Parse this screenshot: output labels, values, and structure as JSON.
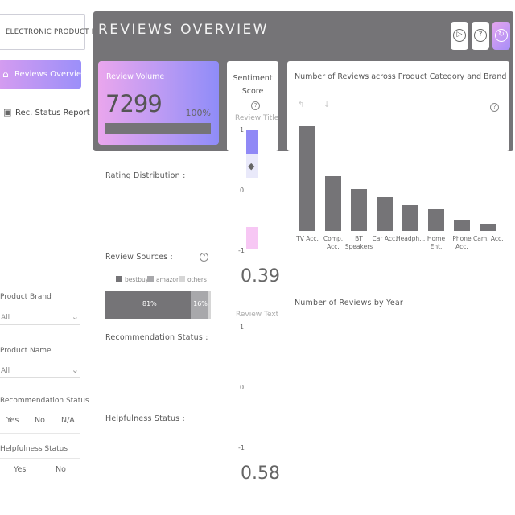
{
  "app": {
    "logo_text": "ELECTRONIC PRODUCT DATA"
  },
  "nav": [
    {
      "label": "Reviews Overview",
      "icon": "home-icon",
      "active": true
    },
    {
      "label": "Rec. Status Report",
      "icon": "report-icon",
      "active": false
    }
  ],
  "filters": {
    "brand": {
      "label": "Product Brand",
      "value": "All"
    },
    "name": {
      "label": "Product Name",
      "value": "All"
    },
    "recommendation": {
      "label": "Recommendation Status",
      "options": [
        "Yes",
        "No",
        "N/A"
      ]
    },
    "helpfulness": {
      "label": "Helpfulness Status",
      "options": [
        "Yes",
        "No"
      ]
    }
  },
  "header": {
    "title": "REVIEWS OVERVIEW",
    "buttons": [
      "play-circle-icon",
      "help-icon",
      "refresh-icon"
    ]
  },
  "colors": {
    "accent_start": "#eaa6ed",
    "accent_end": "#8f8cf8",
    "header": "#757477"
  },
  "review_volume": {
    "label": "Review Volume",
    "value": "7299",
    "percent": "100%"
  },
  "sentiment": {
    "title_line1": "Sentiment",
    "title_line2": "Score",
    "review_title_label": "Review Title",
    "review_title_score": "0.39",
    "review_text_label": "Review Text",
    "review_text_score": "0.58",
    "axis": [
      "1",
      "0",
      "-1"
    ]
  },
  "sections": {
    "rating_distribution": "Rating Distribution :",
    "review_sources": "Review Sources :",
    "recommendation_status": "Recommendation Status :",
    "helpfulness_status": "Helpfulness Status :",
    "reviews_by_year": "Number of Reviews by Year"
  },
  "review_sources": {
    "legend": [
      "bestbuy",
      "amazon",
      "others"
    ],
    "values": [
      81,
      16,
      3
    ],
    "labels": [
      "81%",
      "16%"
    ]
  },
  "chart_data": {
    "type": "bar",
    "title": "Number of Reviews across Product Category and Brand",
    "categories": [
      "TV Acc.",
      "Comp. Acc.",
      "BT Speakers",
      "Car Acc.",
      "Headph...",
      "Home Ent.",
      "Phone Acc.",
      "Cam. Acc."
    ],
    "values": [
      100,
      52,
      40,
      32,
      25,
      21,
      10,
      7
    ]
  }
}
